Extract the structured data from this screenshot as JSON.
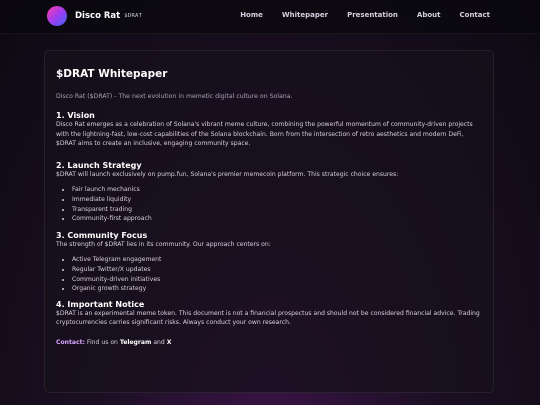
{
  "nav": {
    "brand_name": "Disco Rat",
    "brand_ticker": "$DRAT",
    "links": [
      "Home",
      "Whitepaper",
      "Presentation",
      "About",
      "Contact"
    ]
  },
  "doc": {
    "title": "$DRAT Whitepaper",
    "tagline": "Disco Rat ($DRAT) - The next evolution in memetic digital culture on Solana.",
    "sections": [
      {
        "heading": "1. Vision",
        "body": "Disco Rat emerges as a celebration of Solana's vibrant meme culture, combining the powerful momentum of community-driven projects with the lightning-fast, low-cost capabilities of the Solana blockchain. Born from the intersection of retro aesthetics and modern DeFi, $DRAT aims to create an inclusive, engaging community space."
      },
      {
        "heading": "2. Launch Strategy",
        "body": "$DRAT will launch exclusively on pump.fun, Solana's premier memecoin platform. This strategic choice ensures:",
        "items": [
          "Fair launch mechanics",
          "Immediate liquidity",
          "Transparent trading",
          "Community-first approach"
        ]
      },
      {
        "heading": "3. Community Focus",
        "body": "The strength of $DRAT lies in its community. Our approach centers on:",
        "items": [
          "Active Telegram engagement",
          "Regular Twitter/X updates",
          "Community-driven initiatives",
          "Organic growth strategy"
        ]
      },
      {
        "heading": "4. Important Notice",
        "body": "$DRAT is an experimental meme token. This document is not a financial prospectus and should not be considered financial advice. Trading cryptocurrencies carries significant risks. Always conduct your own research."
      }
    ],
    "contact": {
      "label": "Contact:",
      "prefix": "Find us on",
      "telegram": "Telegram",
      "and": "and",
      "x": "X"
    }
  },
  "colors": {
    "accent": "#d9a6ff",
    "logo_gradient": [
      "#ff3ea5",
      "#a23cf0",
      "#3a63f5"
    ],
    "background": "#0d0a12"
  }
}
